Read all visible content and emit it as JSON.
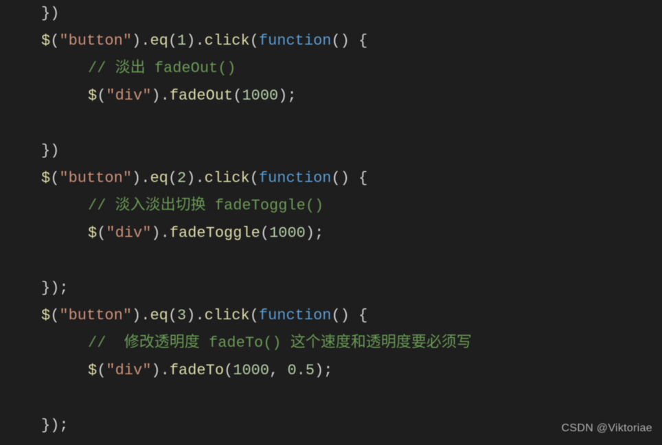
{
  "code": {
    "line1": {
      "full": "})"
    },
    "line2": {
      "jq": "$",
      "p1": "(",
      "str1": "\"button\"",
      "p2": ")",
      "dot1": ".",
      "m1": "eq",
      "p3": "(",
      "n1": "1",
      "p4": ")",
      "dot2": ".",
      "m2": "click",
      "p5": "(",
      "kw": "function",
      "p6": "() {"
    },
    "line3": {
      "c": "// 淡出 fadeOut()"
    },
    "line4": {
      "jq": "$",
      "p1": "(",
      "str1": "\"div\"",
      "p2": ")",
      "dot1": ".",
      "m1": "fadeOut",
      "p3": "(",
      "n1": "1000",
      "p4": ");"
    },
    "line5": {
      "full": "})"
    },
    "line6": {
      "jq": "$",
      "p1": "(",
      "str1": "\"button\"",
      "p2": ")",
      "dot1": ".",
      "m1": "eq",
      "p3": "(",
      "n1": "2",
      "p4": ")",
      "dot2": ".",
      "m2": "click",
      "p5": "(",
      "kw": "function",
      "p6": "() {"
    },
    "line7": {
      "c": "// 淡入淡出切换 fadeToggle()"
    },
    "line8": {
      "jq": "$",
      "p1": "(",
      "str1": "\"div\"",
      "p2": ")",
      "dot1": ".",
      "m1": "fadeToggle",
      "p3": "(",
      "n1": "1000",
      "p4": ");"
    },
    "line9": {
      "full": "});"
    },
    "line10": {
      "jq": "$",
      "p1": "(",
      "str1": "\"button\"",
      "p2": ")",
      "dot1": ".",
      "m1": "eq",
      "p3": "(",
      "n1": "3",
      "p4": ")",
      "dot2": ".",
      "m2": "click",
      "p5": "(",
      "kw": "function",
      "p6": "() {"
    },
    "line11": {
      "c": "//  修改透明度 fadeTo() 这个速度和透明度要必须写"
    },
    "line12": {
      "jq": "$",
      "p1": "(",
      "str1": "\"div\"",
      "p2": ")",
      "dot1": ".",
      "m1": "fadeTo",
      "p3": "(",
      "n1": "1000",
      "comma": ", ",
      "n2": "0.5",
      "p4": ");"
    },
    "line13": {
      "full": "});"
    }
  },
  "watermark": "CSDN @Viktoriae"
}
